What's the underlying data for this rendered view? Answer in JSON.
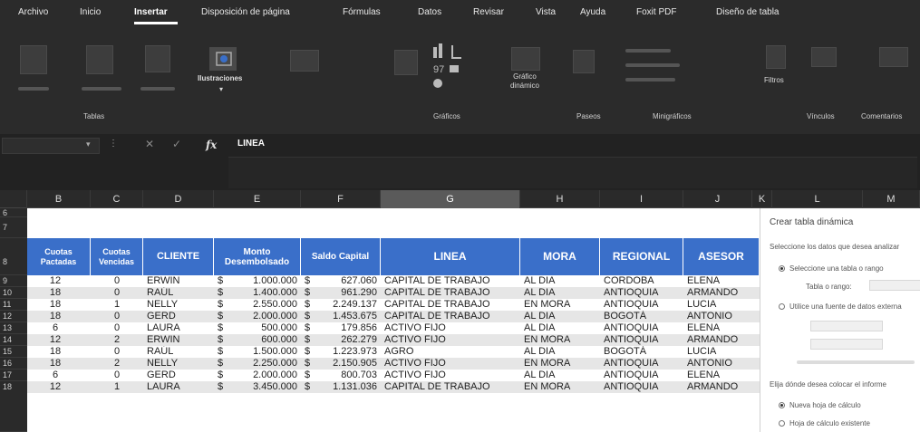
{
  "menu": {
    "items": [
      "Archivo",
      "Inicio",
      "Insertar",
      "Disposición de página",
      "Fórmulas",
      "Datos",
      "Revisar",
      "Vista",
      "Ayuda",
      "Foxit PDF",
      "Diseño de tabla"
    ],
    "active": "Insertar"
  },
  "ribbon": {
    "ilustraciones_label": "Ilustraciones",
    "grafico_label": "Gráfico dinámico",
    "filtros_label": "Filtros",
    "groups": {
      "tablas": "Tablas",
      "graficos": "Gráficos",
      "paseos": "Paseos",
      "minigraficos": "Minigráficos",
      "vinculos": "Vínculos",
      "comentarios": "Comentarios"
    }
  },
  "formula_bar": {
    "fx": "fx",
    "value": "LINEA"
  },
  "columns": {
    "letters": [
      "B",
      "C",
      "D",
      "E",
      "F",
      "G",
      "H",
      "I",
      "J",
      "K",
      "L",
      "M"
    ],
    "selected": "G"
  },
  "rows": {
    "numbers": [
      "6",
      "7",
      "8",
      "9",
      "10",
      "11",
      "12",
      "13",
      "14",
      "15",
      "16",
      "17",
      "18"
    ]
  },
  "table": {
    "headers": {
      "cuotas_pactadas": "Cuotas Pactadas",
      "cuotas_vencidas": "Cuotas Vencidas",
      "cliente": "CLIENTE",
      "monto": "Monto Desembolsado",
      "saldo": "Saldo Capital",
      "linea": "LINEA",
      "mora": "MORA",
      "regional": "REGIONAL",
      "asesor": "ASESOR"
    },
    "rows": [
      {
        "pactadas": "12",
        "vencidas": "0",
        "cliente": "ERWIN",
        "monto": "1.000.000",
        "saldo": "627.060",
        "linea": "CAPITAL DE TRABAJO",
        "mora": "AL DIA",
        "regional": "CORDOBA",
        "asesor": "ELENA"
      },
      {
        "pactadas": "18",
        "vencidas": "0",
        "cliente": "RAÚL",
        "monto": "1.400.000",
        "saldo": "961.290",
        "linea": "CAPITAL DE TRABAJO",
        "mora": "AL DIA",
        "regional": "ANTIOQUIA",
        "asesor": "ARMANDO"
      },
      {
        "pactadas": "18",
        "vencidas": "1",
        "cliente": "NELLY",
        "monto": "2.550.000",
        "saldo": "2.249.137",
        "linea": "CAPITAL DE TRABAJO",
        "mora": "EN MORA",
        "regional": "ANTIOQUIA",
        "asesor": "LUCIA"
      },
      {
        "pactadas": "18",
        "vencidas": "0",
        "cliente": "GERD",
        "monto": "2.000.000",
        "saldo": "1.453.675",
        "linea": "CAPITAL DE TRABAJO",
        "mora": "AL DIA",
        "regional": "BOGOTÁ",
        "asesor": "ANTONIO"
      },
      {
        "pactadas": "6",
        "vencidas": "0",
        "cliente": "LAURA",
        "monto": "500.000",
        "saldo": "179.856",
        "linea": "ACTIVO FIJO",
        "mora": "AL DIA",
        "regional": "ANTIOQUIA",
        "asesor": "ELENA"
      },
      {
        "pactadas": "12",
        "vencidas": "2",
        "cliente": "ERWIN",
        "monto": "600.000",
        "saldo": "262.279",
        "linea": "ACTIVO FIJO",
        "mora": "EN MORA",
        "regional": "ANTIOQUIA",
        "asesor": "ARMANDO"
      },
      {
        "pactadas": "18",
        "vencidas": "0",
        "cliente": "RAÚL",
        "monto": "1.500.000",
        "saldo": "1.223.973",
        "linea": "AGRO",
        "mora": "AL DIA",
        "regional": "BOGOTÁ",
        "asesor": "LUCIA"
      },
      {
        "pactadas": "18",
        "vencidas": "2",
        "cliente": "NELLY",
        "monto": "2.250.000",
        "saldo": "2.150.905",
        "linea": "ACTIVO FIJO",
        "mora": "EN MORA",
        "regional": "ANTIOQUIA",
        "asesor": "ANTONIO"
      },
      {
        "pactadas": "6",
        "vencidas": "0",
        "cliente": "GERD",
        "monto": "2.000.000",
        "saldo": "800.703",
        "linea": "ACTIVO FIJO",
        "mora": "AL DIA",
        "regional": "ANTIOQUIA",
        "asesor": "ELENA"
      },
      {
        "pactadas": "12",
        "vencidas": "1",
        "cliente": "LAURA",
        "monto": "3.450.000",
        "saldo": "1.131.036",
        "linea": "CAPITAL DE TRABAJO",
        "mora": "EN MORA",
        "regional": "ANTIOQUIA",
        "asesor": "ARMANDO"
      }
    ],
    "currency": "$"
  },
  "pivot_pane": {
    "title": "Crear tabla dinámica",
    "choose_data": "Seleccione los datos que desea analizar",
    "option_table": "Seleccione una tabla o rango",
    "table_range_label": "Tabla o rango:",
    "option_external": "Utilice una fuente de datos externa",
    "choose_location": "Elija dónde desea colocar el informe",
    "option_new_sheet": "Nueva hoja de cálculo",
    "option_existing_sheet": "Hoja de cálculo existente"
  },
  "colors": {
    "header_blue": "#3a6fc9",
    "row_band": "#e6e6e6",
    "ribbon_bg": "#2b2b2b"
  }
}
